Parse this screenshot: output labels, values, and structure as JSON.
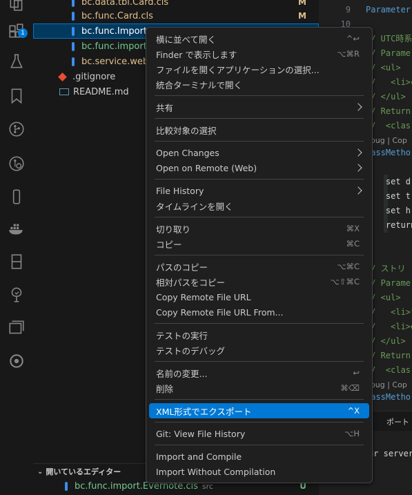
{
  "activity_bar": {
    "extensions_badge": "1"
  },
  "explorer": {
    "files": [
      {
        "name": "bc.data.tbl.Card.cls",
        "status": "M",
        "name_color": "#e2c08d",
        "icon_color": "#3b8eea"
      },
      {
        "name": "bc.func.Card.cls",
        "status": "M",
        "name_color": "#e2c08d",
        "icon_color": "#3b8eea"
      },
      {
        "name": "bc.func.Import",
        "status": "",
        "name_color": "#ffffff",
        "icon_color": "#3b8eea"
      },
      {
        "name": "bc.func.import",
        "status": "",
        "name_color": "#73c991",
        "icon_color": "#3b8eea"
      },
      {
        "name": "bc.service.web",
        "status": "",
        "name_color": "#e2c08d",
        "icon_color": "#3b8eea"
      },
      {
        "name": ".gitignore",
        "status": "",
        "name_color": "#cccccc",
        "icon_color": "#e84e31"
      },
      {
        "name": "README.md",
        "status": "",
        "name_color": "#cccccc",
        "icon_color": "#519aba"
      }
    ],
    "open_editors": {
      "header": "開いているエディター",
      "file_name": "bc.func.import.Evernote.cls",
      "folder": "src",
      "status": "U"
    }
  },
  "editor": {
    "lines": [
      {
        "num": "9",
        "text": "Parameter",
        "cls": "c-keyword"
      },
      {
        "num": "10",
        "text": "",
        "cls": "c-plain"
      },
      {
        "num": "",
        "text": "// UTC時系",
        "cls": "c-comment"
      },
      {
        "num": "",
        "text": "// Parame",
        "cls": "c-comment"
      },
      {
        "num": "",
        "text": "// <ul>",
        "cls": "c-comment"
      },
      {
        "num": "",
        "text": "//   <li>c",
        "cls": "c-comment"
      },
      {
        "num": "",
        "text": "// </ul>",
        "cls": "c-comment"
      },
      {
        "num": "",
        "text": "// Return",
        "cls": "c-comment"
      },
      {
        "num": "",
        "text": "//  <clas",
        "cls": "c-comment"
      },
      {
        "num": "",
        "text": "ebug | Cop",
        "cls": "c-lens"
      },
      {
        "num": "",
        "text": "lassMetho",
        "cls": "c-keyword"
      },
      {
        "num": "",
        "text": "",
        "cls": "c-plain"
      },
      {
        "num": "",
        "text": "    set d",
        "cls": "c-plain"
      },
      {
        "num": "",
        "text": "    set t",
        "cls": "c-plain"
      },
      {
        "num": "",
        "text": "    set h",
        "cls": "c-plain"
      },
      {
        "num": "",
        "text": "    return",
        "cls": "c-plain"
      },
      {
        "num": "",
        "text": "",
        "cls": "c-plain"
      },
      {
        "num": "",
        "text": "",
        "cls": "c-plain"
      },
      {
        "num": "",
        "text": "// ストリ",
        "cls": "c-comment"
      },
      {
        "num": "",
        "text": "// Parame",
        "cls": "c-comment"
      },
      {
        "num": "",
        "text": "// <ul>",
        "cls": "c-comment"
      },
      {
        "num": "",
        "text": "//   <li>f",
        "cls": "c-comment"
      },
      {
        "num": "",
        "text": "//   <li>e",
        "cls": "c-comment"
      },
      {
        "num": "",
        "text": "// </ul>",
        "cls": "c-comment"
      },
      {
        "num": "",
        "text": "// Return",
        "cls": "c-comment"
      },
      {
        "num": "",
        "text": "//  <clas",
        "cls": "c-comment"
      },
      {
        "num": "",
        "text": "ebug | Cop",
        "cls": "c-lens"
      },
      {
        "num": "",
        "text": "lassMetho",
        "cls": "c-keyword"
      }
    ],
    "panel_tab": "ポート",
    "bottom_text": "ur server"
  },
  "context_menu": {
    "groups": [
      [
        {
          "label": "横に並べて開く",
          "shortcut": "^↩"
        },
        {
          "label": "Finder で表示します",
          "shortcut": "⌥⌘R"
        },
        {
          "label": "ファイルを開くアプリケーションの選択...",
          "shortcut": ""
        },
        {
          "label": "統合ターミナルで開く",
          "shortcut": ""
        }
      ],
      [
        {
          "label": "共有",
          "shortcut": "",
          "submenu": true
        }
      ],
      [
        {
          "label": "比較対象の選択",
          "shortcut": ""
        }
      ],
      [
        {
          "label": "Open Changes",
          "shortcut": "",
          "submenu": true
        },
        {
          "label": "Open on Remote (Web)",
          "shortcut": "",
          "submenu": true
        }
      ],
      [
        {
          "label": "File History",
          "shortcut": "",
          "submenu": true
        },
        {
          "label": "タイムラインを開く",
          "shortcut": ""
        }
      ],
      [
        {
          "label": "切り取り",
          "shortcut": "⌘X"
        },
        {
          "label": "コピー",
          "shortcut": "⌘C"
        }
      ],
      [
        {
          "label": "パスのコピー",
          "shortcut": "⌥⌘C"
        },
        {
          "label": "相対パスをコピー",
          "shortcut": "⌥⇧⌘C"
        },
        {
          "label": "Copy Remote File URL",
          "shortcut": ""
        },
        {
          "label": "Copy Remote File URL From...",
          "shortcut": ""
        }
      ],
      [
        {
          "label": "テストの実行",
          "shortcut": ""
        },
        {
          "label": "テストのデバッグ",
          "shortcut": ""
        }
      ],
      [
        {
          "label": "名前の変更...",
          "shortcut": "↩"
        },
        {
          "label": "削除",
          "shortcut": "⌘⌫"
        }
      ],
      [
        {
          "label": "XML形式でエクスポート",
          "shortcut": "^X",
          "highlighted": true
        }
      ],
      [
        {
          "label": "Git: View File History",
          "shortcut": "⌥H"
        }
      ],
      [
        {
          "label": "Import and Compile",
          "shortcut": ""
        },
        {
          "label": "Import Without Compilation",
          "shortcut": ""
        }
      ]
    ]
  }
}
